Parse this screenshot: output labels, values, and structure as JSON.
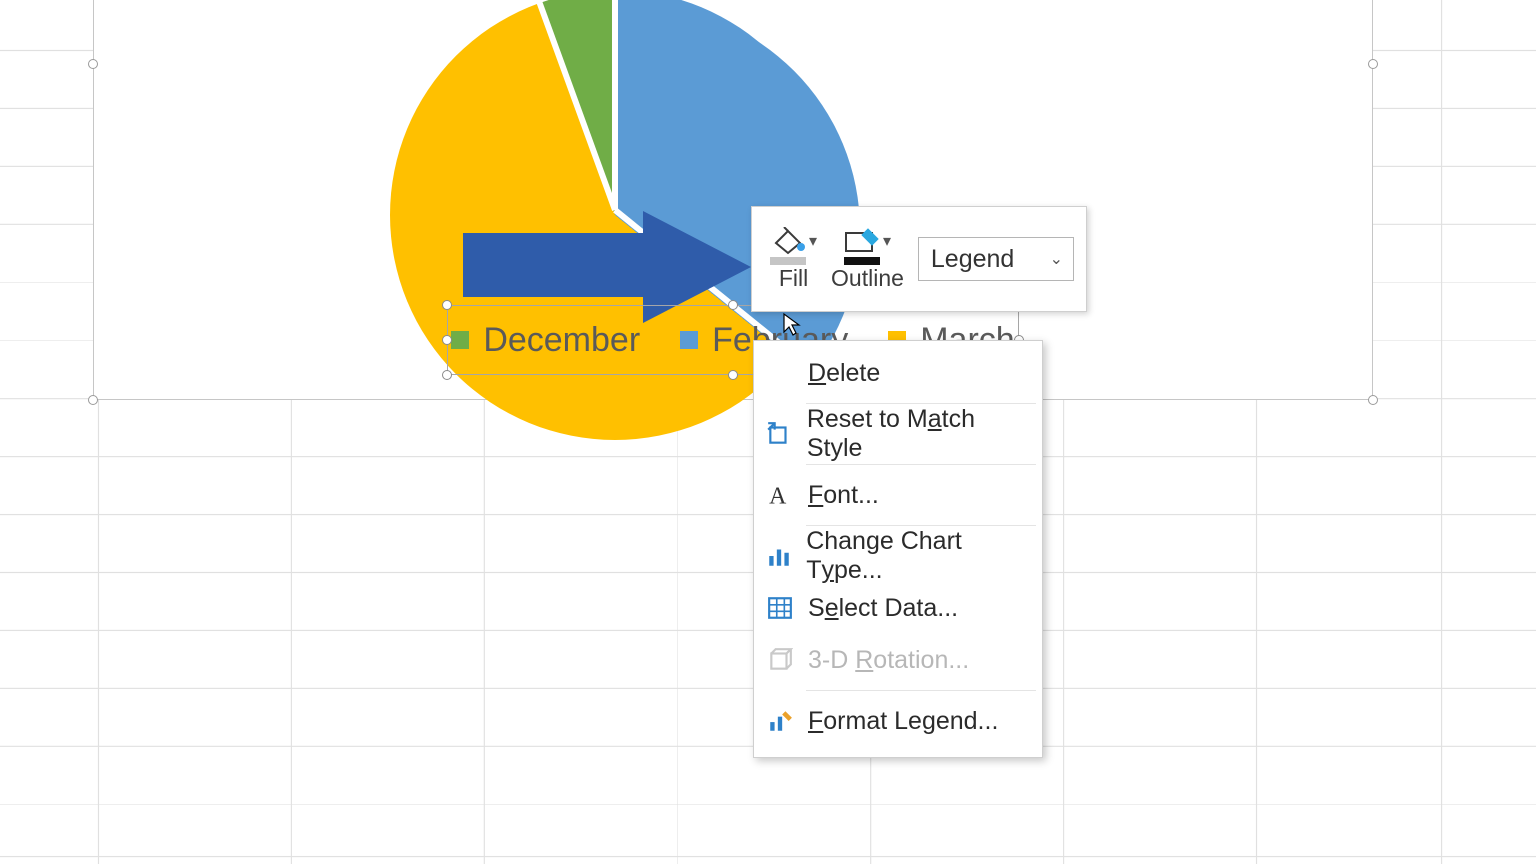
{
  "chart_data": {
    "type": "pie",
    "categories": [
      "December",
      "February",
      "March"
    ],
    "values": [
      5,
      36,
      59
    ],
    "colors": [
      "#70ad47",
      "#5b9bd5",
      "#ffc000"
    ],
    "exploded_index": 1,
    "title": ""
  },
  "legend": {
    "items": [
      {
        "label": "December",
        "color": "#70ad47"
      },
      {
        "label": "February",
        "color": "#5b9bd5"
      },
      {
        "label": "March",
        "color": "#ffc000"
      }
    ]
  },
  "mini_toolbar": {
    "fill_label": "Fill",
    "outline_label": "Outline",
    "element_selector": "Legend"
  },
  "context_menu": {
    "delete": "Delete",
    "reset": "Reset to Match Style",
    "font": "Font...",
    "change_chart": "Change Chart Type...",
    "select_data": "Select Data...",
    "rotation_3d": "3-D Rotation...",
    "format_legend": "Format Legend..."
  }
}
